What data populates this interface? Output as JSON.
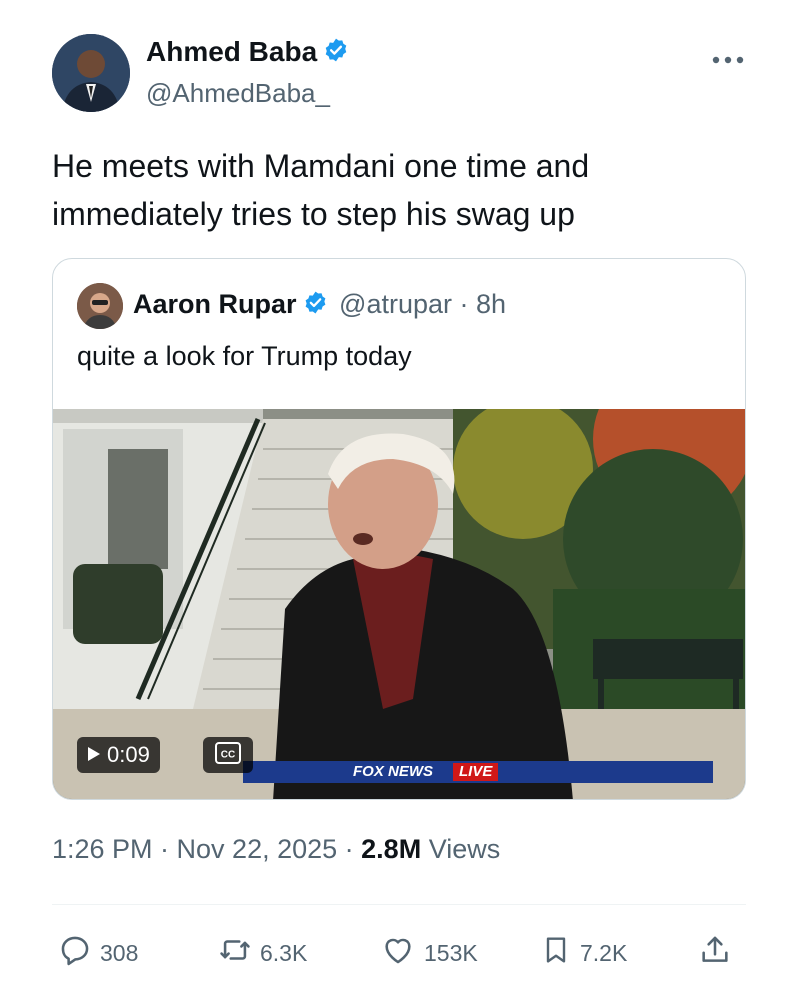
{
  "tweet": {
    "author_name": "Ahmed Baba",
    "author_handle": "@AhmedBaba_",
    "more_icon": "more-dots-icon",
    "text": "He meets with Mamdani one time and immediately tries to step his swag up",
    "timestamp": "1:26 PM · Nov 22, 2025 · ",
    "views_count": "2.8M",
    "views_label": " Views"
  },
  "quote": {
    "author_name": "Aaron Rupar",
    "author_handle": "@atrupar · 8h",
    "text": "quite a look for Trump today",
    "video": {
      "duration": "0:09",
      "cc_label": "CC",
      "ticker_brand": "FOX NEWS",
      "ticker_live": "LIVE"
    }
  },
  "actions": {
    "replies": "308",
    "reposts": "6.3K",
    "likes": "153K",
    "bookmarks": "7.2K"
  },
  "colors": {
    "verified": "#1d9bf0",
    "secondary_text": "#536471",
    "border": "#cfd9de"
  }
}
